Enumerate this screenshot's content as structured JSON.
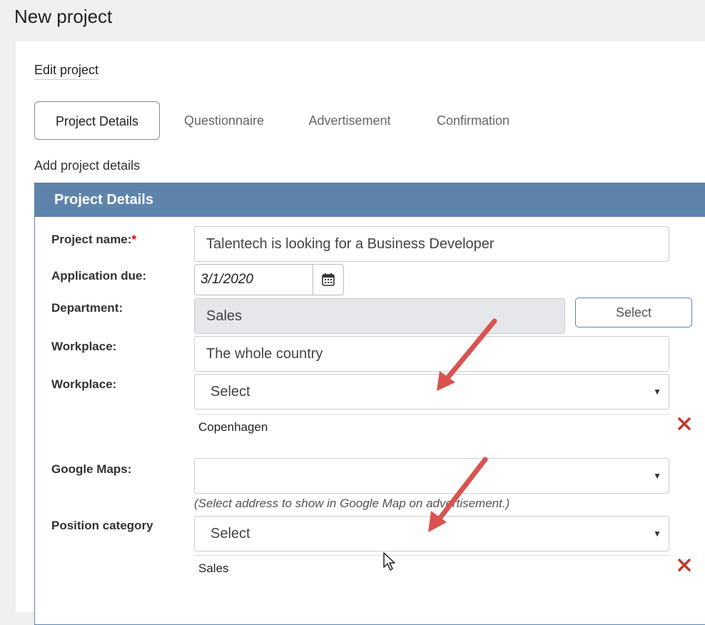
{
  "page": {
    "title": "New project"
  },
  "edit_link": "Edit project",
  "tabs": [
    {
      "label": "Project Details",
      "active": true
    },
    {
      "label": "Questionnaire",
      "active": false
    },
    {
      "label": "Advertisement",
      "active": false
    },
    {
      "label": "Confirmation",
      "active": false
    }
  ],
  "section_hint": "Add project details",
  "panel": {
    "title": "Project Details",
    "fields": {
      "project_name": {
        "label": "Project name:",
        "required_mark": "*",
        "value": "Talentech is looking for a Business Developer"
      },
      "application_due": {
        "label": "Application due:",
        "value": "3/1/2020",
        "icon": "calendar-icon"
      },
      "department": {
        "label": "Department:",
        "value": "Sales",
        "button": "Select"
      },
      "workplace_text": {
        "label": "Workplace:",
        "value": "The whole country"
      },
      "workplace_select": {
        "label": "Workplace:",
        "value": "Select",
        "selected_items": [
          "Copenhagen"
        ]
      },
      "google_maps": {
        "label": "Google Maps:",
        "value": "",
        "hint": "(Select address to show in Google Map on advertisement.)"
      },
      "position_category": {
        "label": "Position category",
        "value": "Select",
        "selected_items": [
          "Sales"
        ]
      }
    }
  },
  "colors": {
    "panel_header": "#5f84ab",
    "required": "#dd0000",
    "remove": "#c0392b",
    "arrow": "#d9534f"
  }
}
